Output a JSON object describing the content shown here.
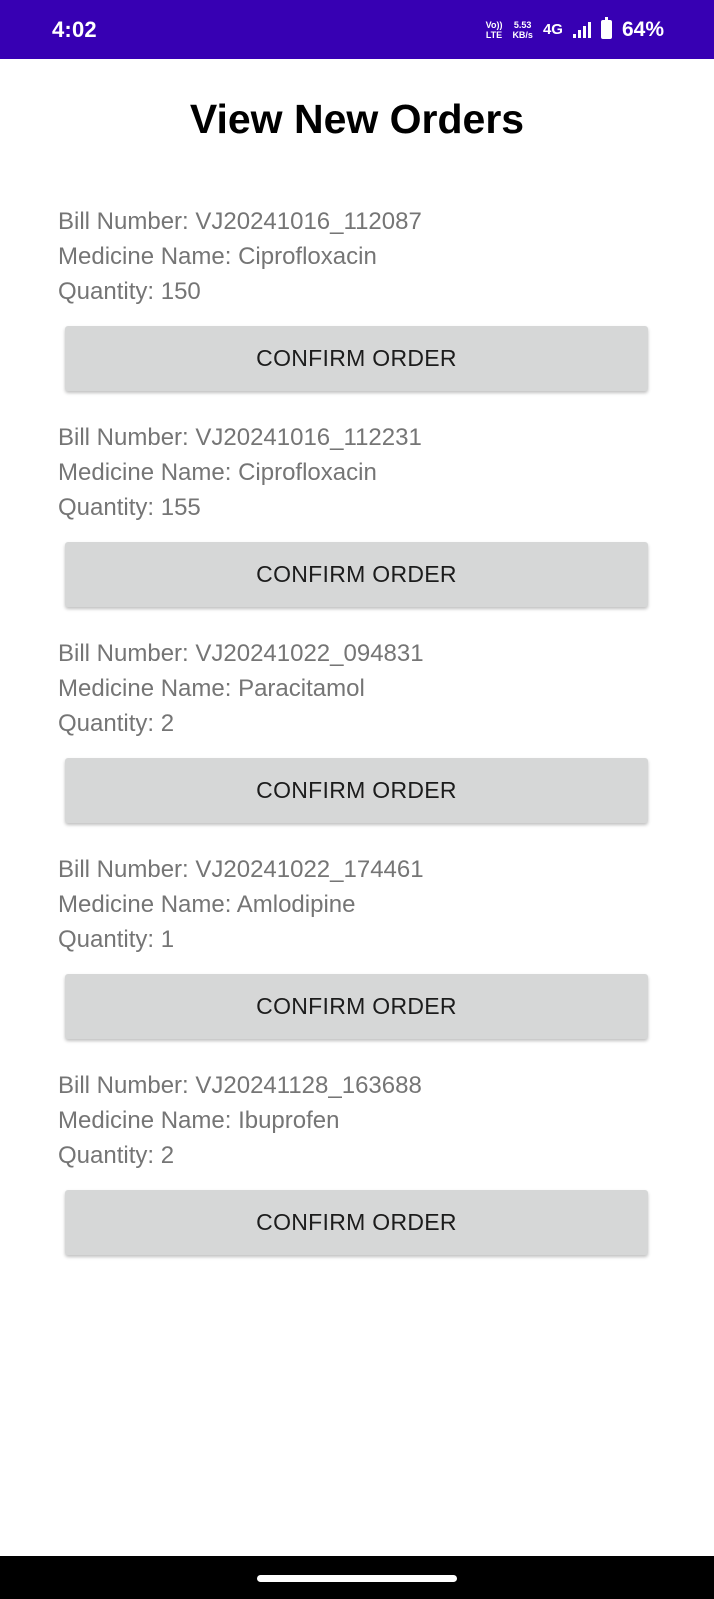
{
  "status_bar": {
    "time": "4:02",
    "volte_top": "Vo))",
    "volte_bottom": "LTE",
    "speed_value": "5.53",
    "speed_unit": "KB/s",
    "network": "4G",
    "battery": "64%",
    "bg_color": "#3700b3"
  },
  "page": {
    "title": "View New Orders"
  },
  "orders": [
    {
      "bill": "Bill Number: VJ20241016_112087",
      "medicine": "Medicine Name: Ciprofloxacin",
      "quantity": "Quantity: 150",
      "button_label": "CONFIRM ORDER"
    },
    {
      "bill": "Bill Number: VJ20241016_112231",
      "medicine": "Medicine Name: Ciprofloxacin",
      "quantity": "Quantity: 155",
      "button_label": "CONFIRM ORDER"
    },
    {
      "bill": "Bill Number: VJ20241022_094831",
      "medicine": "Medicine Name: Paracitamol",
      "quantity": "Quantity: 2",
      "button_label": "CONFIRM ORDER"
    },
    {
      "bill": "Bill Number: VJ20241022_174461",
      "medicine": "Medicine Name: Amlodipine",
      "quantity": "Quantity: 1",
      "button_label": "CONFIRM ORDER"
    },
    {
      "bill": "Bill Number: VJ20241128_163688",
      "medicine": "Medicine Name: Ibuprofen",
      "quantity": "Quantity: 2",
      "button_label": "CONFIRM ORDER"
    }
  ]
}
